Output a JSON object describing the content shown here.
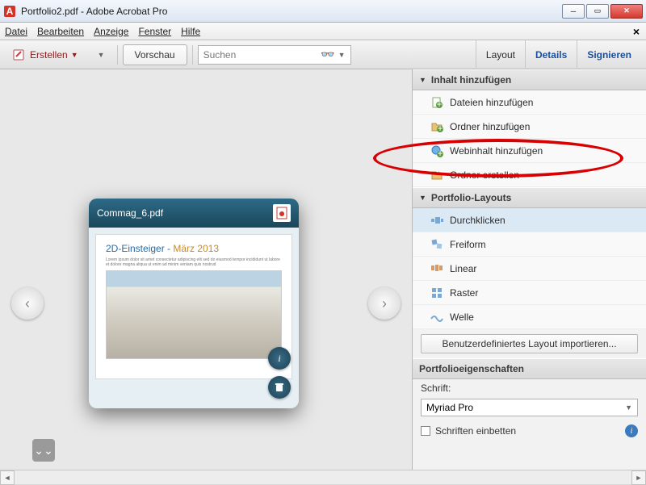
{
  "window": {
    "title": "Portfolio2.pdf - Adobe Acrobat Pro"
  },
  "menu": {
    "datei": "Datei",
    "bearbeiten": "Bearbeiten",
    "anzeige": "Anzeige",
    "fenster": "Fenster",
    "hilfe": "Hilfe"
  },
  "toolbar": {
    "erstellen": "Erstellen",
    "vorschau": "Vorschau",
    "search_placeholder": "Suchen",
    "layout": "Layout",
    "details": "Details",
    "signieren": "Signieren"
  },
  "card": {
    "filename": "Commag_6.pdf",
    "doc_title_prefix": "2D-Einsteiger - ",
    "doc_title_month": "März 2013"
  },
  "panel": {
    "inhalt_hdr": "Inhalt hinzufügen",
    "add_files": "Dateien hinzufügen",
    "add_folder": "Ordner hinzufügen",
    "add_web": "Webinhalt hinzufügen",
    "create_folder": "Ordner erstellen",
    "layouts_hdr": "Portfolio-Layouts",
    "layouts": {
      "durchklicken": "Durchklicken",
      "freiform": "Freiform",
      "linear": "Linear",
      "raster": "Raster",
      "welle": "Welle"
    },
    "import_layout": "Benutzerdefiniertes Layout importieren...",
    "props_hdr": "Portfolioeigenschaften",
    "schrift_label": "Schrift:",
    "schrift_value": "Myriad Pro",
    "embed_fonts": "Schriften einbetten"
  }
}
